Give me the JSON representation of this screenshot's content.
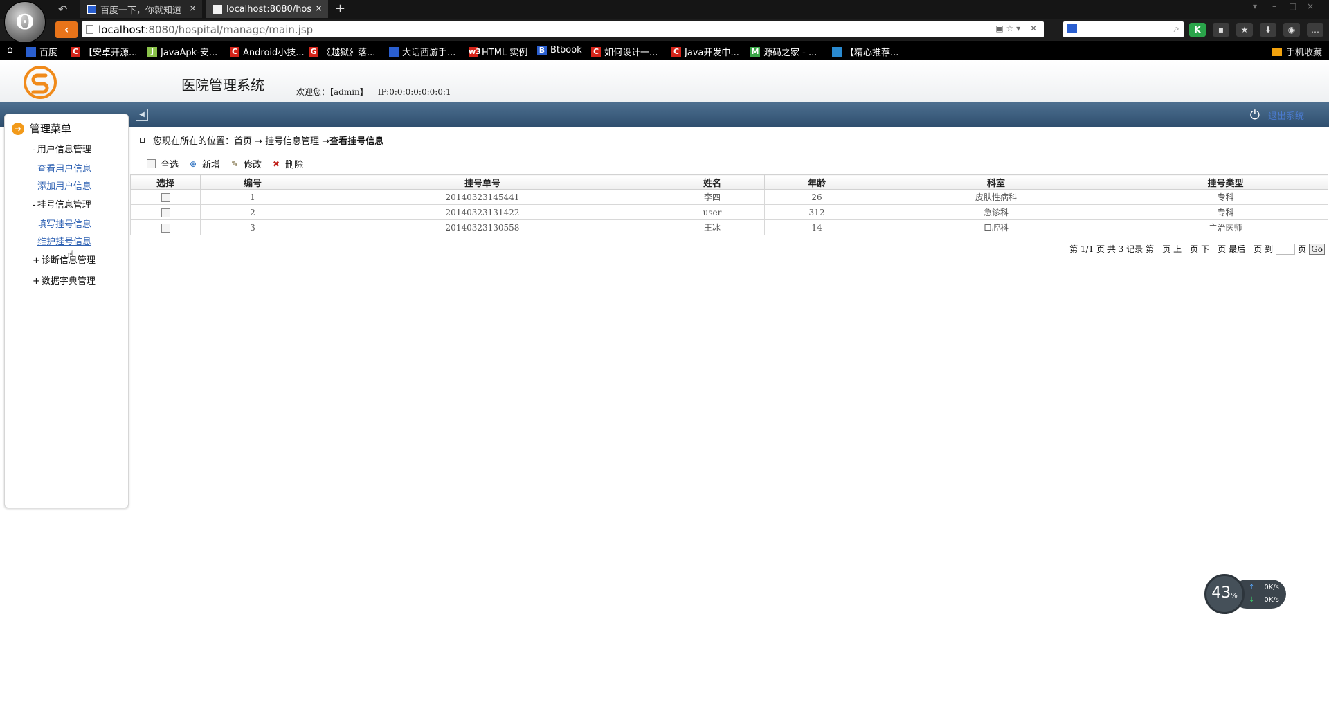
{
  "browser": {
    "tabs": [
      {
        "label": "百度一下，你就知道",
        "active": false
      },
      {
        "label": "localhost:8080/hos",
        "active": true
      }
    ],
    "new_tab": "+",
    "url_host": "localhost",
    "url_path": ":8080/hospital/manage/main.jsp",
    "bookmarks": [
      {
        "label": "百度",
        "icon": "baidu-icon",
        "icon_text": "",
        "color": "#2a5fd0"
      },
      {
        "label": "【安卓开源...",
        "icon": "csdn-icon",
        "icon_text": "C",
        "color": "#d4241a"
      },
      {
        "label": "JavaApk-安...",
        "icon": "javaapk-icon",
        "icon_text": "J",
        "color": "#8bc34a"
      },
      {
        "label": "Android小技...",
        "icon": "csdn-icon",
        "icon_text": "C",
        "color": "#d4241a"
      },
      {
        "label": "《越狱》落...",
        "icon": "g-icon",
        "icon_text": "G",
        "color": "#d4241a"
      },
      {
        "label": "大话西游手...",
        "icon": "grid-icon",
        "icon_text": "",
        "color": "#2a5fd0"
      },
      {
        "label": "HTML 实例",
        "icon": "w3-icon",
        "icon_text": "w3",
        "color": "#d4241a"
      },
      {
        "label": "Btbook",
        "icon": "b-icon",
        "icon_text": "B",
        "color": "#2a5fd0"
      },
      {
        "label": "如何设计一...",
        "icon": "csdn-icon",
        "icon_text": "C",
        "color": "#d4241a"
      },
      {
        "label": "Java开发中...",
        "icon": "csdn-icon",
        "icon_text": "C",
        "color": "#d4241a"
      },
      {
        "label": "源码之家 - ...",
        "icon": "m-icon",
        "icon_text": "M",
        "color": "#3aa648"
      },
      {
        "label": "【精心推荐...",
        "icon": "globe-icon",
        "icon_text": "",
        "color": "#2a8ad0"
      }
    ],
    "mobile_bookmarks": "手机收藏"
  },
  "app": {
    "title": "医院管理系统",
    "welcome": "欢迎您：【admin】",
    "ip": "IP:0:0:0:0:0:0:0:1",
    "logout": "退出系统"
  },
  "sidebar": {
    "title": "管理菜单",
    "groups": [
      {
        "sign": "-",
        "label": "用户信息管理",
        "items": [
          "查看用户信息",
          "添加用户信息"
        ]
      },
      {
        "sign": "-",
        "label": "挂号信息管理",
        "items": [
          "填写挂号信息",
          "维护挂号信息"
        ]
      },
      {
        "sign": "+",
        "label": "诊断信息管理",
        "items": []
      },
      {
        "sign": "+",
        "label": "数据字典管理",
        "items": []
      }
    ]
  },
  "breadcrumb": {
    "prefix": "您现在所在的位置：首页 → 挂号信息管理 → ",
    "current": "查看挂号信息"
  },
  "toolbar": {
    "select_all": "全选",
    "add": "新增",
    "edit": "修改",
    "delete": "删除"
  },
  "table": {
    "columns": [
      "选择",
      "编号",
      "挂号单号",
      "姓名",
      "年龄",
      "科室",
      "挂号类型"
    ],
    "rows": [
      {
        "id": "1",
        "reg_no": "20140323145441",
        "name": "李四",
        "age": "26",
        "dept": "皮肤性病科",
        "type": "专科"
      },
      {
        "id": "2",
        "reg_no": "20140323131422",
        "name": "user",
        "age": "312",
        "dept": "急诊科",
        "type": "专科"
      },
      {
        "id": "3",
        "reg_no": "20140323130558",
        "name": "王冰",
        "age": "14",
        "dept": "口腔科",
        "type": "主治医师"
      }
    ]
  },
  "pager": {
    "summary": "第 1/1 页 共 3 记录",
    "first": "第一页",
    "prev": "上一页",
    "next": "下一页",
    "last": "最后一页",
    "goto_label": "到",
    "page_unit": "页",
    "go": "Go"
  },
  "speed_widget": {
    "percent": "43",
    "percent_unit": "%",
    "up": "0K/s",
    "down": "0K/s"
  }
}
